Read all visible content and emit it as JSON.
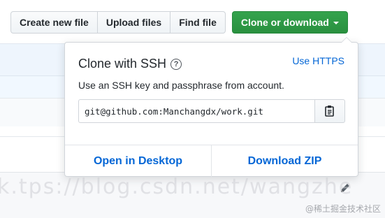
{
  "toolbar": {
    "create_file": "Create new file",
    "upload_files": "Upload files",
    "find_file": "Find file",
    "clone_download": "Clone or download"
  },
  "clone_panel": {
    "title": "Clone with SSH",
    "switch_protocol": "Use HTTPS",
    "description": "Use an SSH key and passphrase from account.",
    "url": "git@github.com:Manchangdx/work.git",
    "open_desktop": "Open in Desktop",
    "download_zip": "Download ZIP"
  },
  "watermarks": {
    "url": "k.tps://blog.csdn.net/wangzhe",
    "corner": "@稀土掘金技术社区"
  },
  "colors": {
    "primary_green": "#2ea44f",
    "link_blue": "#0366d6",
    "text": "#24292e",
    "border": "#d1d5da"
  },
  "icons": {
    "help": "question-circle-icon",
    "copy": "clipboard-icon",
    "caret": "caret-down-icon",
    "edit": "pencil-icon"
  }
}
